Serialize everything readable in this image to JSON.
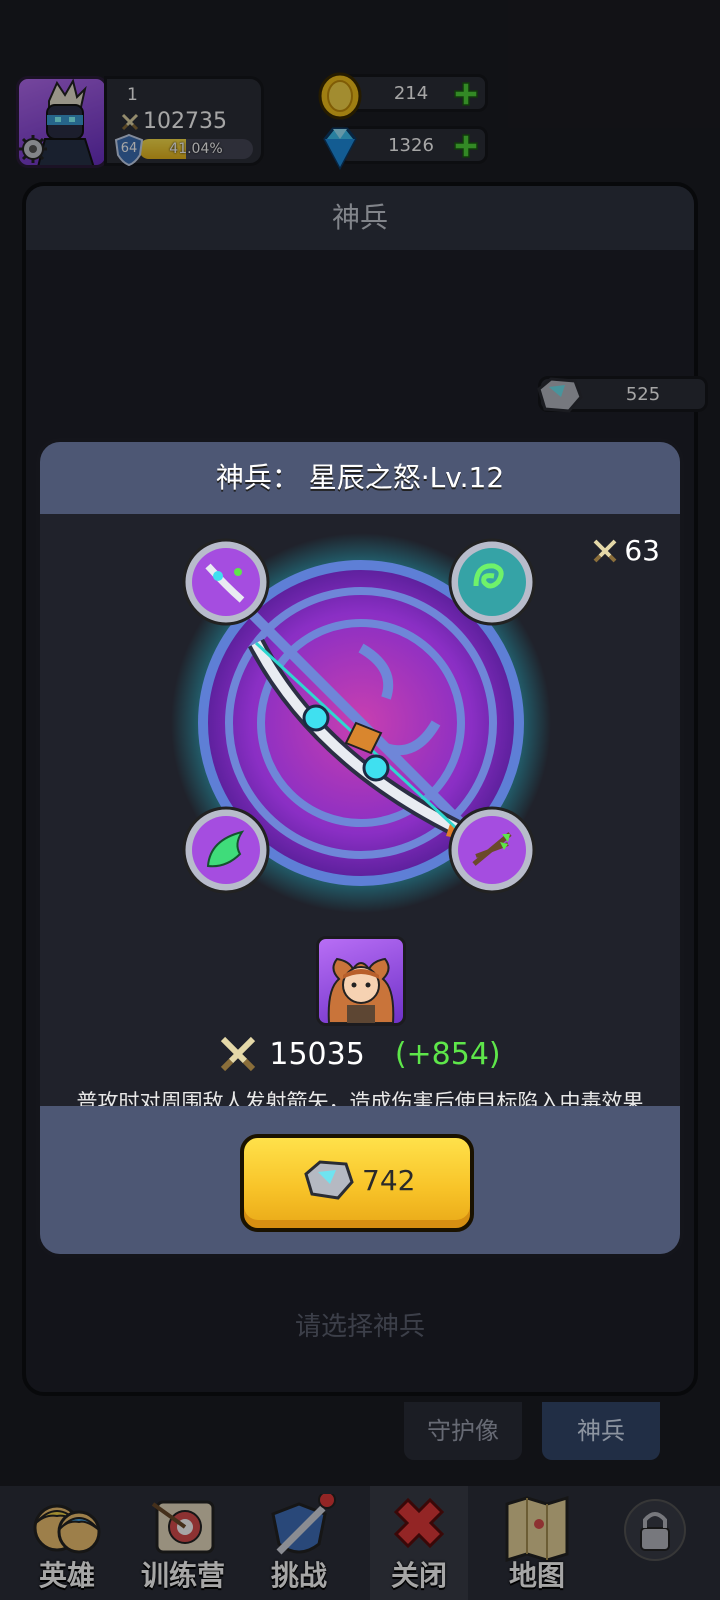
{
  "hud": {
    "player_level": "1",
    "player_power": "102735",
    "rank_badge": "64",
    "xp_text": "41.04%",
    "xp_progress": 0.4104,
    "gold": "214",
    "gems": "1326"
  },
  "main_panel": {
    "title": "神兵",
    "stone_count": "525",
    "select_hint": "请选择神兵"
  },
  "tabs": {
    "guardian": "守护像",
    "weapon": "神兵"
  },
  "modal": {
    "title": "神兵：  星辰之怒·Lv.12",
    "power": "63",
    "hero_stat": "15035",
    "stat_bonus": "(+854)",
    "description": "普攻时对周围敌人发射箭矢，造成伤害后使目标陷入中毒效果",
    "upgrade_cost": "742"
  },
  "nav": {
    "heroes": "英雄",
    "training": "训练营",
    "challenge": "挑战",
    "close": "关闭",
    "map": "地图"
  },
  "colors": {
    "accent_yellow": "#f8c429",
    "header_blue": "#4d5774",
    "bonus_green": "#5ee64a",
    "magic_purple": "#8a2fc4"
  },
  "icons": [
    "gear-icon",
    "sword-icon",
    "shield-icon",
    "gold-coin-icon",
    "diamond-icon",
    "plus-icon",
    "stone-icon",
    "bow-icon",
    "skill-icon",
    "lock-icon",
    "close-icon",
    "map-icon"
  ]
}
